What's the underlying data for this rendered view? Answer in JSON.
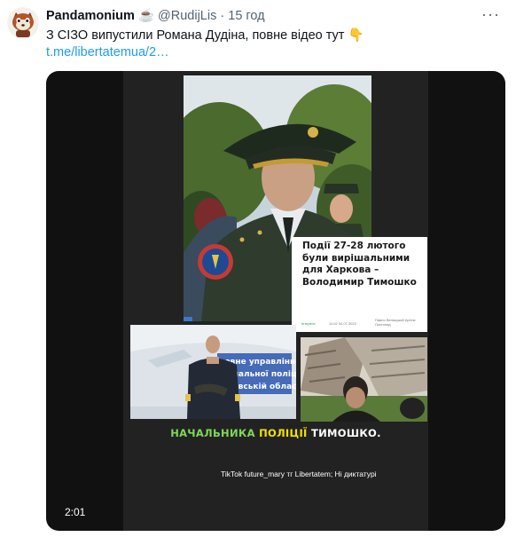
{
  "tweet": {
    "author_name": "Pandamonium",
    "author_emoji": "☕",
    "author_handle": "@RudijLis",
    "separator": "·",
    "time": "15 год",
    "more_glyph": "···",
    "text": "З СІЗО випустили Романа Дудіна, повне відео тут 👇",
    "link_text": "t.me/libertatemua/2…"
  },
  "video": {
    "duration": "2:01",
    "article_title": "Події 27-28 лютого були вирішальними для Харкова – Володимир Тимошко",
    "article_source": "Інтерв'ю",
    "article_date": "11:02 04.07.2022",
    "article_authors": "Павло Велицький Артем Листопад",
    "banner_line1": "Головне управління",
    "banner_line2": "Національної поліції",
    "banner_line3": "в Харківській області",
    "caption_part1": "НАЧАЛЬНИКА ",
    "caption_part2": "ПОЛІЦІЇ ",
    "caption_part3": "ТИМОШКО.",
    "watermark": "TikTok future_mary   тг Libertatem; Ні диктатурі"
  },
  "colors": {
    "link": "#1d9bf0",
    "caption_green": "#7ed957",
    "caption_yellow": "#f2e200"
  }
}
